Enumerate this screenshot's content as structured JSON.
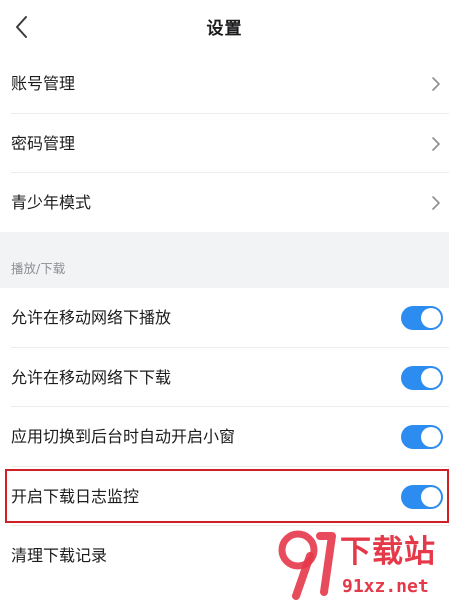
{
  "header": {
    "back_icon": "chevron-left-icon",
    "title": "设置"
  },
  "account_group": {
    "items": [
      {
        "label": "账号管理",
        "icon": "chevron-right-icon"
      },
      {
        "label": "密码管理",
        "icon": "chevron-right-icon"
      },
      {
        "label": "青少年模式",
        "icon": "chevron-right-icon"
      }
    ]
  },
  "playback_section": {
    "title": "播放/下载",
    "items": [
      {
        "label": "允许在移动网络下播放",
        "toggle_on": true
      },
      {
        "label": "允许在移动网络下下载",
        "toggle_on": true
      },
      {
        "label": "应用切换到后台时自动开启小窗",
        "toggle_on": true
      },
      {
        "label": "开启下载日志监控",
        "toggle_on": true,
        "highlighted": true
      },
      {
        "label": "清理下载记录"
      }
    ]
  },
  "colors": {
    "accent": "#2d8cf0",
    "highlight_border": "#d21f26",
    "background": "#f2f3f5",
    "watermark": "#e5394a"
  },
  "watermark": {
    "title": "下载站",
    "url": "91xz.net"
  }
}
